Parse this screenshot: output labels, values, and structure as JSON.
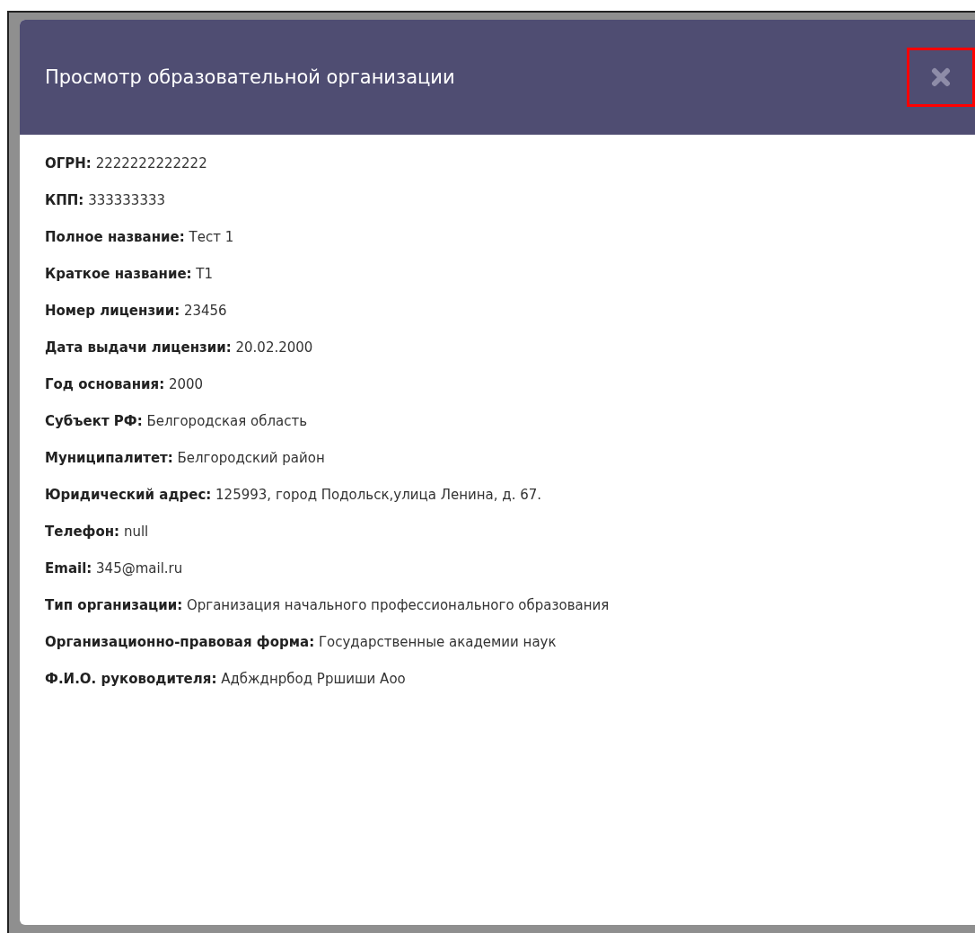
{
  "modal": {
    "title": "Просмотр образовательной организации",
    "close_highlighted": true,
    "fields": [
      {
        "label": "ОГРН:",
        "value": "2222222222222"
      },
      {
        "label": "КПП:",
        "value": "333333333"
      },
      {
        "label": "Полное название:",
        "value": "Тест 1"
      },
      {
        "label": "Краткое название:",
        "value": "Т1"
      },
      {
        "label": "Номер лицензии:",
        "value": "23456"
      },
      {
        "label": "Дата выдачи лицензии:",
        "value": "20.02.2000"
      },
      {
        "label": "Год основания:",
        "value": "2000"
      },
      {
        "label": "Субъект РФ:",
        "value": "Белгородская область"
      },
      {
        "label": "Муниципалитет:",
        "value": "Белгородский район"
      },
      {
        "label": "Юридический адрес:",
        "value": "125993, город Подольск,улица Ленина, д. 67."
      },
      {
        "label": "Телефон:",
        "value": "null"
      },
      {
        "label": "Email:",
        "value": "345@mail.ru"
      },
      {
        "label": "Тип организации:",
        "value": "Организация начального профессионального образования"
      },
      {
        "label": "Организационно-правовая форма:",
        "value": "Государственные академии наук"
      },
      {
        "label": "Ф.И.О. руководителя:",
        "value": "Адбжднрбод Рршиши Аоо"
      }
    ]
  }
}
